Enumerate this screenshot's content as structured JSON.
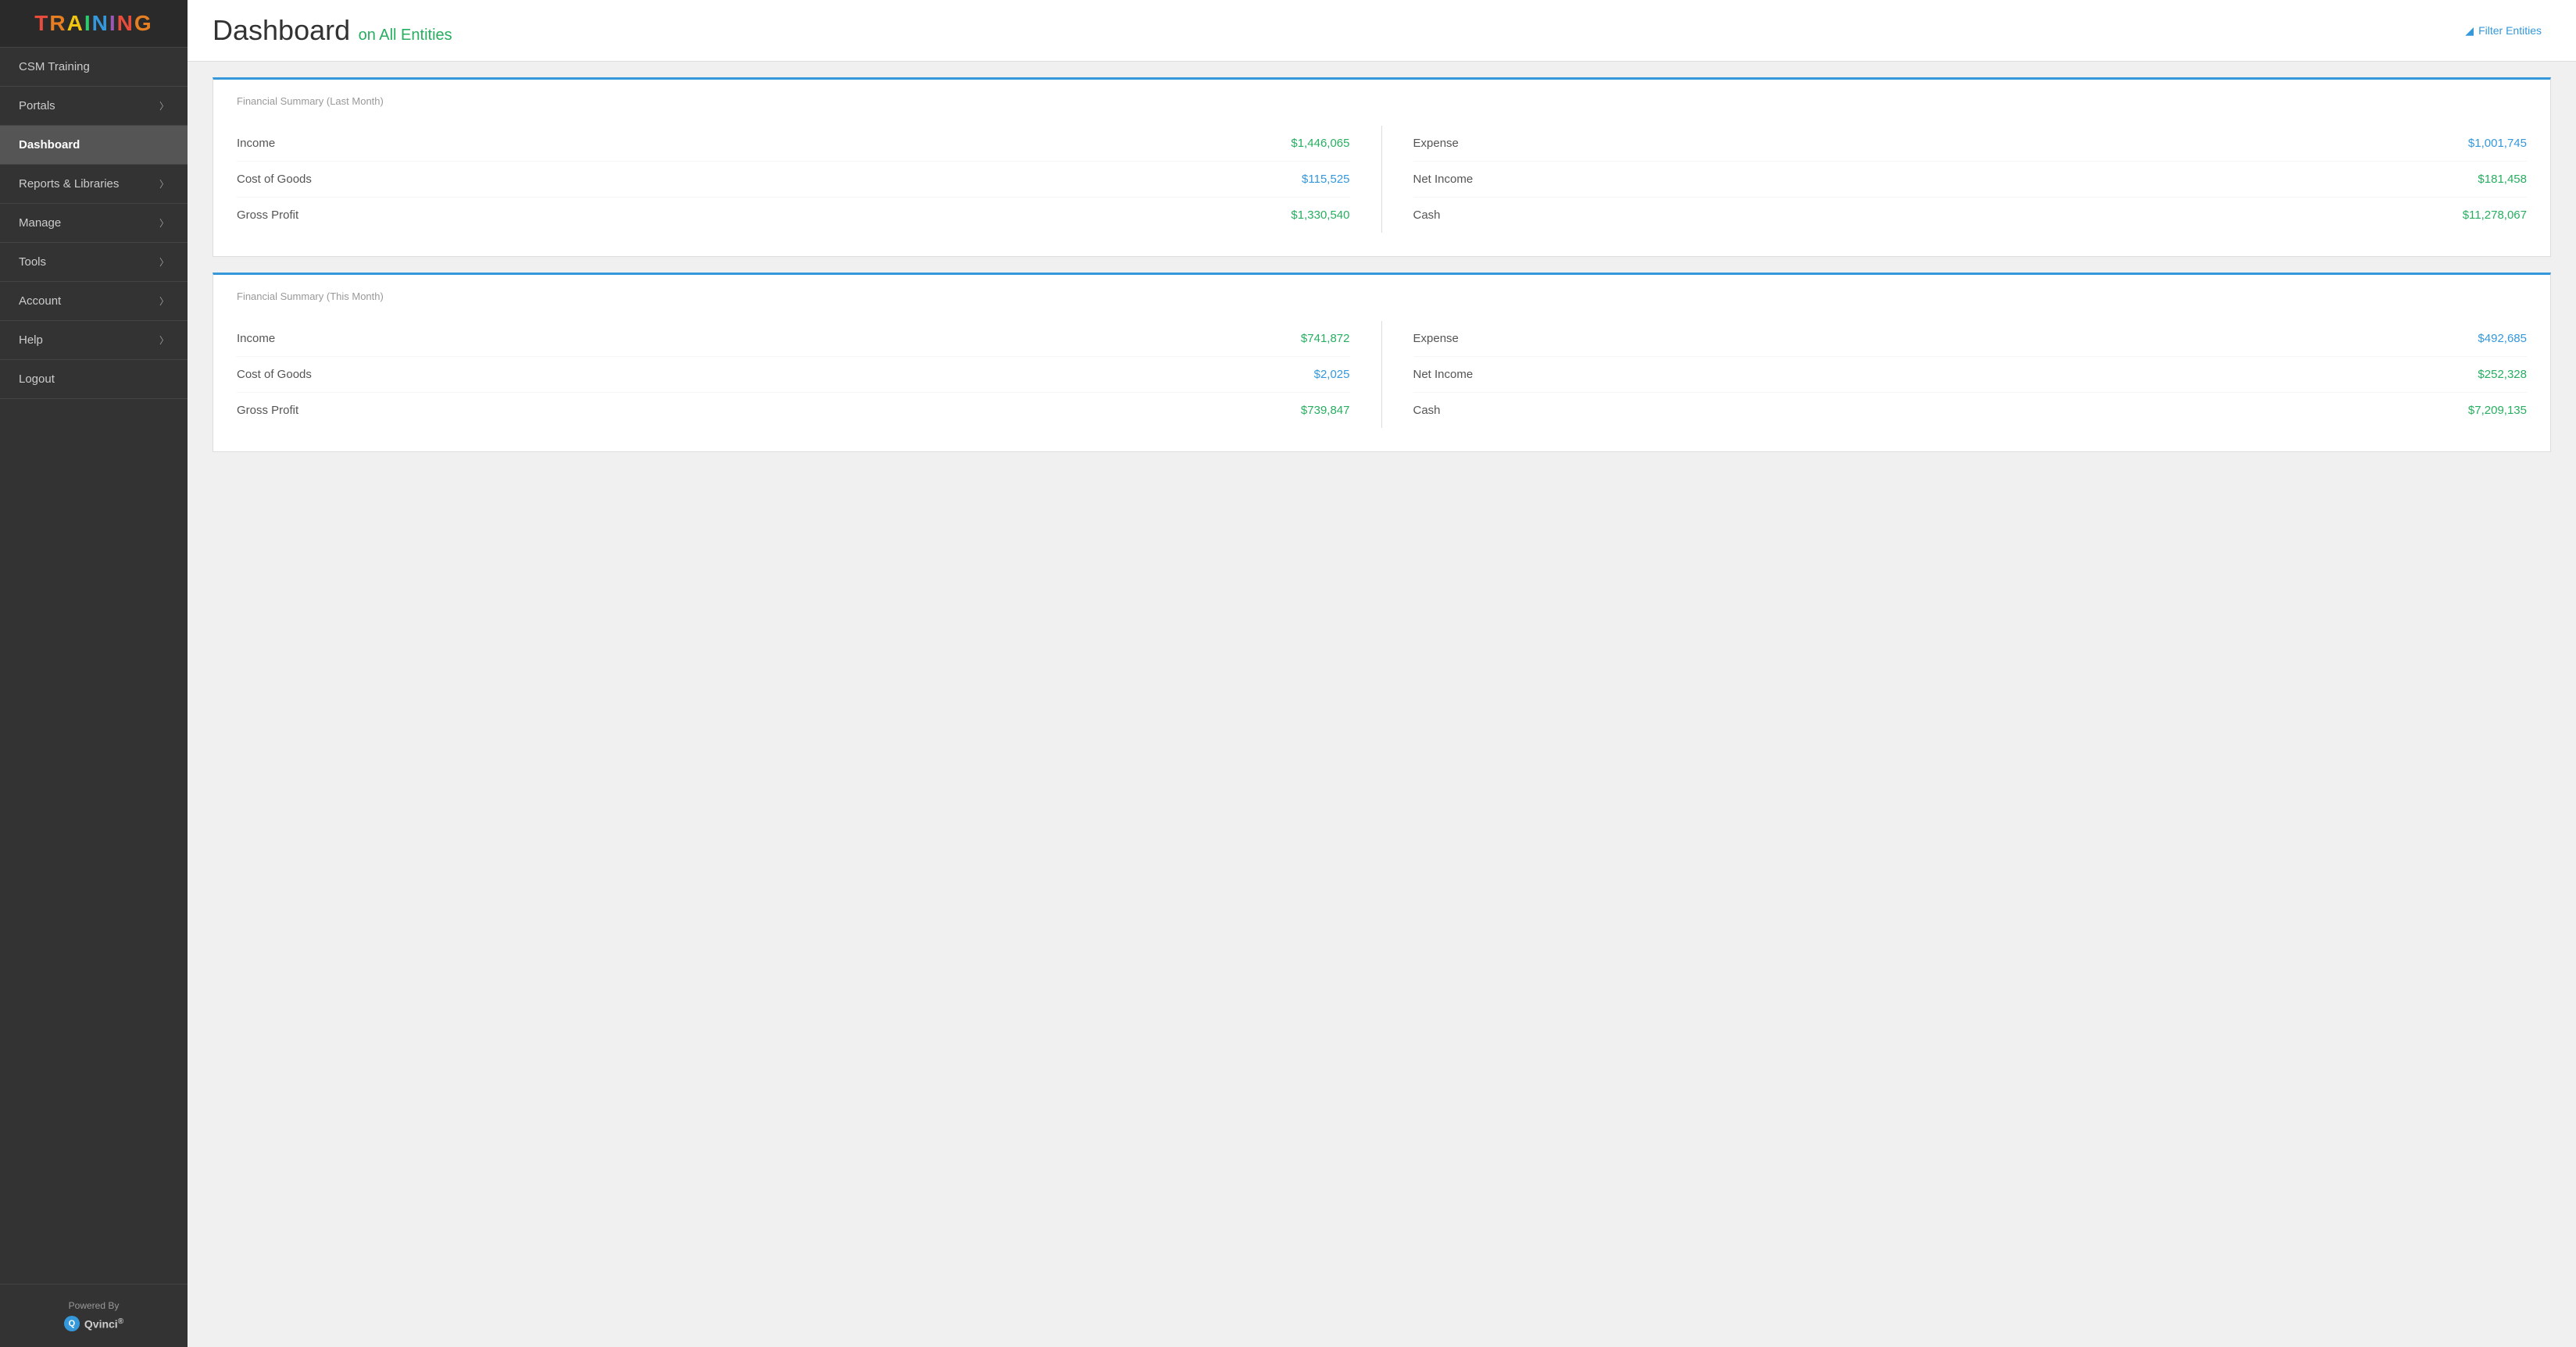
{
  "sidebar": {
    "logo": "TRAINING",
    "items": [
      {
        "id": "csm-training",
        "label": "CSM Training",
        "hasArrow": false,
        "active": false
      },
      {
        "id": "portals",
        "label": "Portals",
        "hasArrow": true,
        "active": false
      },
      {
        "id": "dashboard",
        "label": "Dashboard",
        "hasArrow": false,
        "active": true
      },
      {
        "id": "reports-libraries",
        "label": "Reports & Libraries",
        "hasArrow": true,
        "active": false
      },
      {
        "id": "manage",
        "label": "Manage",
        "hasArrow": true,
        "active": false
      },
      {
        "id": "tools",
        "label": "Tools",
        "hasArrow": true,
        "active": false
      },
      {
        "id": "account",
        "label": "Account",
        "hasArrow": true,
        "active": false
      },
      {
        "id": "help",
        "label": "Help",
        "hasArrow": true,
        "active": false
      },
      {
        "id": "logout",
        "label": "Logout",
        "hasArrow": false,
        "active": false
      }
    ],
    "powered_by_label": "Powered By",
    "qvinci_label": "Qvinci",
    "qvinci_reg": "®"
  },
  "header": {
    "title": "Dashboard",
    "subtitle": "on All Entities",
    "filter_button": "Filter Entities"
  },
  "last_month": {
    "title": "Financial Summary (Last Month)",
    "income_label": "Income",
    "income_value": "$1,446,065",
    "cogs_label": "Cost of Goods",
    "cogs_value": "$115,525",
    "gross_profit_label": "Gross Profit",
    "gross_profit_value": "$1,330,540",
    "expense_label": "Expense",
    "expense_value": "$1,001,745",
    "net_income_label": "Net Income",
    "net_income_value": "$181,458",
    "cash_label": "Cash",
    "cash_value": "$11,278,067"
  },
  "this_month": {
    "title": "Financial Summary (This Month)",
    "income_label": "Income",
    "income_value": "$741,872",
    "cogs_label": "Cost of Goods",
    "cogs_value": "$2,025",
    "gross_profit_label": "Gross Profit",
    "gross_profit_value": "$739,847",
    "expense_label": "Expense",
    "expense_value": "$492,685",
    "net_income_label": "Net Income",
    "net_income_value": "$252,328",
    "cash_label": "Cash",
    "cash_value": "$7,209,135"
  }
}
